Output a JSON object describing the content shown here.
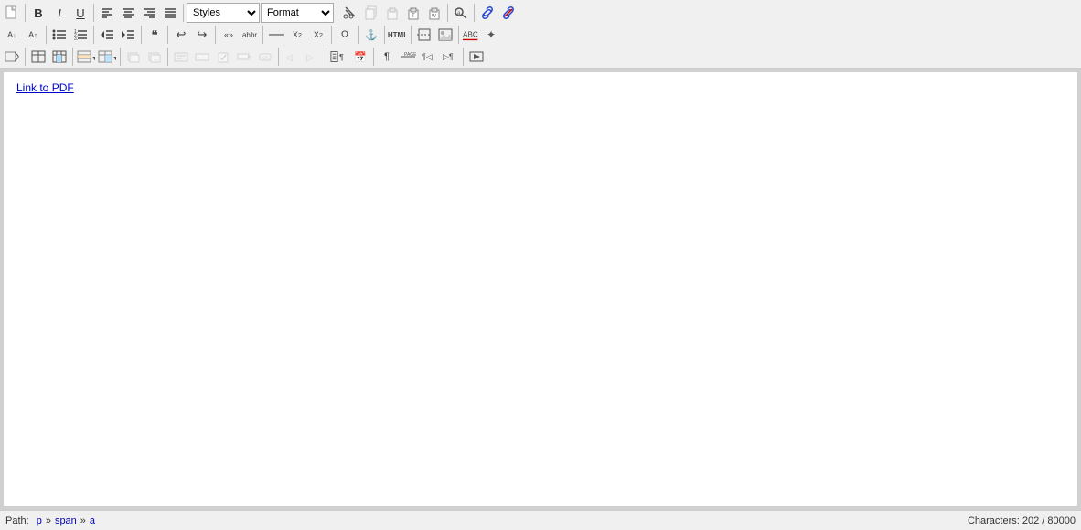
{
  "toolbar": {
    "row1": {
      "new_label": "📄",
      "bold_label": "B",
      "italic_label": "I",
      "underline_label": "U",
      "align_left": "≡",
      "align_center": "≡",
      "align_right": "≡",
      "align_justify": "≡",
      "styles_value": "Styles",
      "format_value": "Format",
      "cut_label": "✂",
      "copy_label": "⎘",
      "paste_label": "📋",
      "paste_text_label": "T",
      "paste_word_label": "W",
      "find_label": "🔍",
      "link_label": "🔗",
      "unlink_label": "🔗"
    },
    "row2": {
      "decrease_font": "A↓",
      "increase_font": "A↑",
      "unordered_list": "•≡",
      "ordered_list": "1≡",
      "outdent": "←≡",
      "indent": "→≡",
      "blockquote": "❝",
      "undo": "↩",
      "redo": "↪",
      "insert_special": "«»",
      "abbr": "abbr",
      "hr": "—",
      "subscript": "x₂",
      "superscript": "x²",
      "insert_char": "Ω",
      "anchor": "⚓",
      "html": "HTML",
      "page_break": "⊟",
      "img": "🖼",
      "spell": "abc",
      "cleanup": "✦"
    },
    "row3": {
      "edit_css": "✏",
      "table_btns": [
        "□",
        "⊞",
        "≡",
        "◫"
      ],
      "layer_btns": [
        "⬡",
        "⬡"
      ],
      "form_btns": [
        "⬜",
        "○",
        "☑",
        "≡",
        "⬜"
      ],
      "direction_btns": [
        "◁",
        "▷"
      ],
      "paragraph": "¶",
      "nonbreaking": "—",
      "para_left": "⊣",
      "para_right": "⊢",
      "show_blocks": "⊞",
      "date_label": "📅",
      "image_label": "🖼"
    }
  },
  "editor": {
    "link_text": "Link to PDF",
    "link_href": "#"
  },
  "status_bar": {
    "path_label": "Path:",
    "path_items": [
      "p",
      "span",
      "a"
    ],
    "characters_label": "Characters: 202 / 80000"
  }
}
